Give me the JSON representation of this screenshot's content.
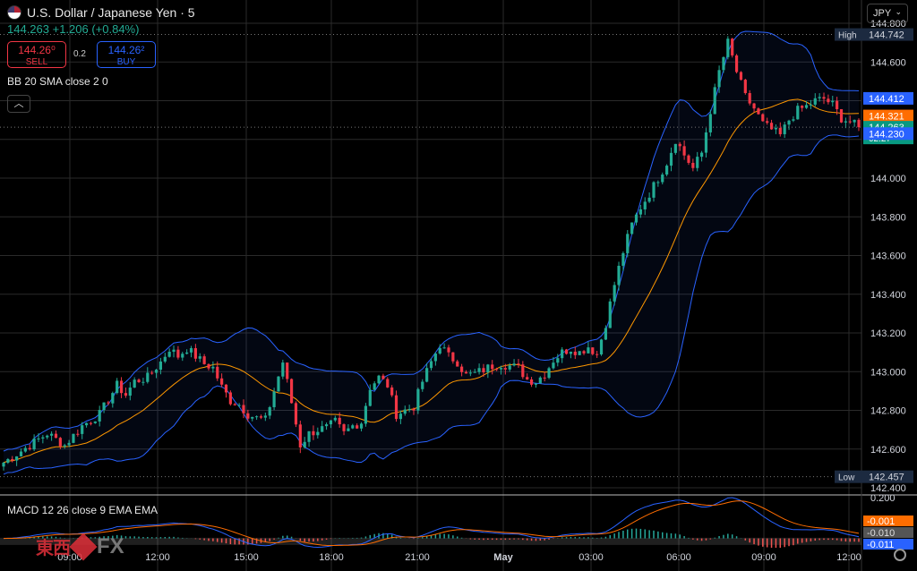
{
  "header": {
    "symbol_title": "U.S. Dollar / Japanese Yen · 5",
    "quote": "144.263  +1.206 (+0.84%)"
  },
  "trade": {
    "sell_price": "144.26⁰",
    "sell_label": "SELL",
    "spread": "0.2",
    "buy_price": "144.26²",
    "buy_label": "BUY"
  },
  "indicator_label": "BB 20 SMA close 2 0",
  "macd_label": "MACD 12 26 close 9 EMA EMA",
  "currency": "JPY",
  "logo": {
    "text_jp": "東西",
    "text_fx": "FX"
  },
  "colors": {
    "up": "#22ab94",
    "down": "#f23645",
    "bb_band": "#2962ff",
    "bb_basis": "#ff9800",
    "macd_line": "#2962ff",
    "signal_line": "#ff6d00",
    "axis_text": "#d1d4dc"
  },
  "chart_data": {
    "type": "candlestick",
    "ylim": [
      142.4,
      144.8
    ],
    "y_ticks": [
      "144.800",
      "144.600",
      "144.400",
      "144.200",
      "144.000",
      "143.800",
      "143.600",
      "143.400",
      "143.200",
      "143.000",
      "142.800",
      "142.600",
      "142.400"
    ],
    "x_ticks": [
      "09:00",
      "12:00",
      "15:00",
      "18:00",
      "21:00",
      "May",
      "03:00",
      "06:00",
      "09:00",
      "12:00"
    ],
    "grid": true,
    "price_labels": [
      {
        "tag": "High",
        "value": "144.742",
        "style": "dark"
      },
      {
        "tag": "",
        "value": "144.412",
        "style": "blue"
      },
      {
        "tag": "",
        "value": "144.321",
        "style": "orange"
      },
      {
        "tag": "",
        "value": "144.263",
        "sub": "02:27",
        "style": "green"
      },
      {
        "tag": "",
        "value": "144.230",
        "style": "blue"
      },
      {
        "tag": "Low",
        "value": "142.457",
        "style": "dark"
      }
    ],
    "price_path": [
      [
        0,
        142.53
      ],
      [
        6,
        142.62
      ],
      [
        10,
        142.68
      ],
      [
        14,
        142.62
      ],
      [
        18,
        142.72
      ],
      [
        22,
        142.78
      ],
      [
        26,
        142.93
      ],
      [
        28,
        142.88
      ],
      [
        30,
        142.95
      ],
      [
        33,
        142.97
      ],
      [
        36,
        143.05
      ],
      [
        38,
        143.12
      ],
      [
        40,
        143.08
      ],
      [
        42,
        143.12
      ],
      [
        44,
        143.08
      ],
      [
        46,
        143.04
      ],
      [
        48,
        143.02
      ],
      [
        50,
        142.92
      ],
      [
        52,
        142.85
      ],
      [
        54,
        142.83
      ],
      [
        56,
        142.78
      ],
      [
        58,
        142.76
      ],
      [
        60,
        142.75
      ],
      [
        62,
        142.9
      ],
      [
        64,
        143.05
      ],
      [
        66,
        142.84
      ],
      [
        68,
        142.62
      ],
      [
        70,
        142.68
      ],
      [
        72,
        142.7
      ],
      [
        74,
        142.71
      ],
      [
        76,
        142.74
      ],
      [
        78,
        142.68
      ],
      [
        80,
        142.72
      ],
      [
        82,
        142.74
      ],
      [
        84,
        142.92
      ],
      [
        86,
        142.97
      ],
      [
        88,
        142.93
      ],
      [
        90,
        142.78
      ],
      [
        92,
        142.8
      ],
      [
        94,
        142.82
      ],
      [
        96,
        142.95
      ],
      [
        98,
        143.05
      ],
      [
        100,
        143.14
      ],
      [
        102,
        143.08
      ],
      [
        104,
        143.05
      ],
      [
        106,
        142.98
      ],
      [
        108,
        142.99
      ],
      [
        110,
        143.01
      ],
      [
        112,
        143.03
      ],
      [
        114,
        143.04
      ],
      [
        116,
        143.03
      ],
      [
        118,
        143.02
      ],
      [
        120,
        142.96
      ],
      [
        122,
        142.95
      ],
      [
        124,
        142.99
      ],
      [
        126,
        143.06
      ],
      [
        128,
        143.1
      ],
      [
        130,
        143.12
      ],
      [
        132,
        143.1
      ],
      [
        134,
        143.13
      ],
      [
        136,
        143.09
      ],
      [
        138,
        143.25
      ],
      [
        140,
        143.45
      ],
      [
        142,
        143.62
      ],
      [
        144,
        143.76
      ],
      [
        146,
        143.85
      ],
      [
        148,
        143.92
      ],
      [
        150,
        144.0
      ],
      [
        152,
        144.08
      ],
      [
        154,
        144.2
      ],
      [
        156,
        144.12
      ],
      [
        158,
        144.05
      ],
      [
        160,
        144.13
      ],
      [
        162,
        144.35
      ],
      [
        164,
        144.55
      ],
      [
        166,
        144.7
      ],
      [
        168,
        144.55
      ],
      [
        170,
        144.42
      ],
      [
        172,
        144.36
      ],
      [
        174,
        144.28
      ],
      [
        176,
        144.25
      ],
      [
        178,
        144.22
      ],
      [
        180,
        144.3
      ],
      [
        182,
        144.35
      ],
      [
        184,
        144.37
      ],
      [
        186,
        144.4
      ],
      [
        188,
        144.41
      ],
      [
        190,
        144.38
      ],
      [
        192,
        144.31
      ],
      [
        194,
        144.29
      ],
      [
        196,
        144.263
      ]
    ],
    "macd": {
      "ylim": [
        -0.015,
        0.2
      ],
      "y_ticks": [
        "0.200"
      ],
      "value_labels": [
        {
          "value": "-0.001",
          "style": "orange"
        },
        {
          "value": "-0.010",
          "style": "grey"
        },
        {
          "value": "-0.011",
          "style": "blue"
        }
      ]
    }
  }
}
